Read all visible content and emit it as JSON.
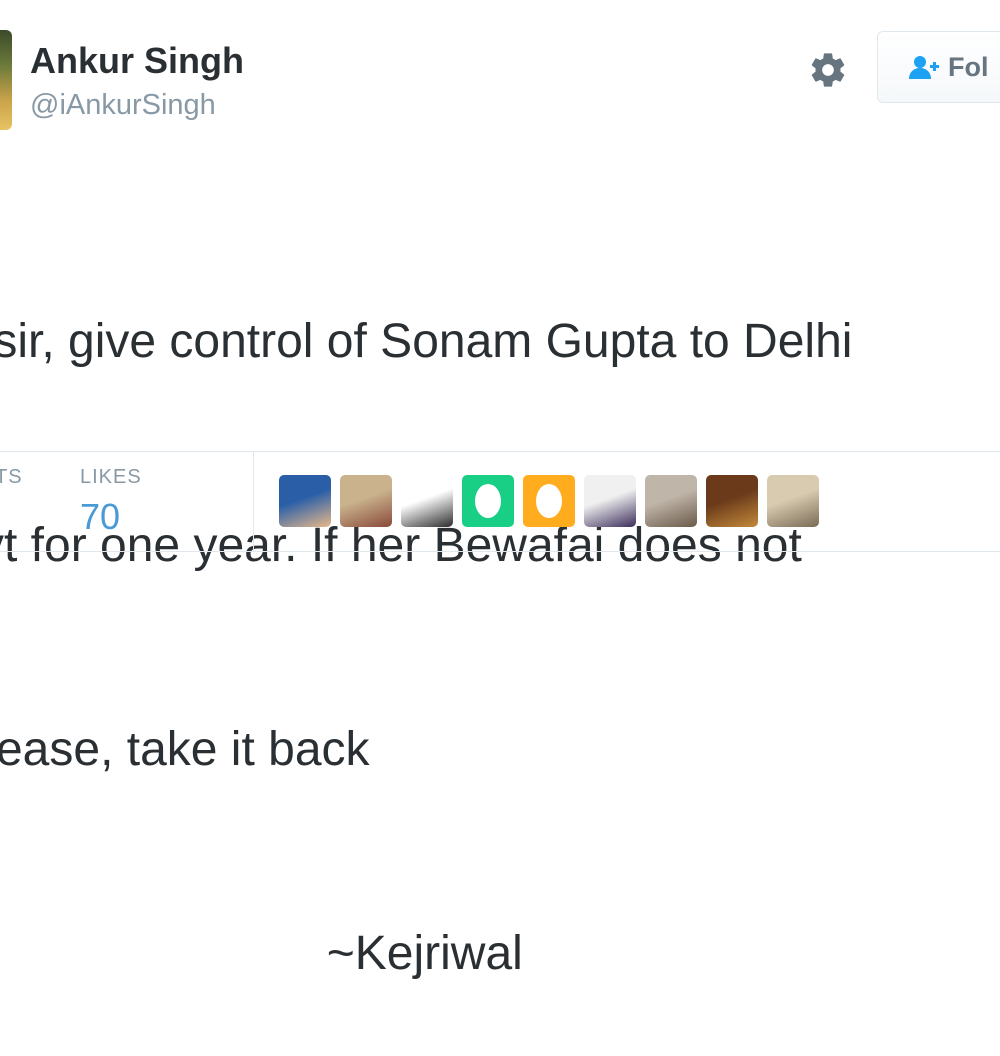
{
  "user": {
    "name": "Ankur Singh",
    "handle": "@iAnkurSingh"
  },
  "actions": {
    "follow_label": "Fol",
    "settings_icon": "gear-icon",
    "follow_icon": "add-user-icon"
  },
  "tweet": {
    "lines": [
      " sir, give control of Sonam Gupta to Delhi",
      "vt for one year. If her Bewafai does not",
      "rease, take it back",
      "                          ~Kejriwal"
    ]
  },
  "stats": {
    "retweets_label": "TS",
    "likes_label": "LIKES",
    "likes_count": "70"
  },
  "likers": [
    {
      "kind": "photo",
      "colors": [
        "#2a5fa8",
        "#e8b98a"
      ]
    },
    {
      "kind": "photo",
      "colors": [
        "#c9b28c",
        "#8a4a3a"
      ]
    },
    {
      "kind": "photo",
      "colors": [
        "#ffffff",
        "#2b2b2b"
      ]
    },
    {
      "kind": "egg",
      "colors": [
        "#19cf86"
      ]
    },
    {
      "kind": "egg",
      "colors": [
        "#ffad1f"
      ]
    },
    {
      "kind": "photo",
      "colors": [
        "#f0f0f0",
        "#3a2c5a"
      ]
    },
    {
      "kind": "photo",
      "colors": [
        "#bfb5a8",
        "#6b5a4a"
      ]
    },
    {
      "kind": "photo",
      "colors": [
        "#6a3a1a",
        "#c48a3a"
      ]
    },
    {
      "kind": "photo",
      "colors": [
        "#d8cbb0",
        "#7a6a55"
      ]
    }
  ],
  "colors": {
    "text": "#292f33",
    "muted": "#8899a6",
    "link": "#4a9ad6",
    "border": "#e1e8ed"
  }
}
